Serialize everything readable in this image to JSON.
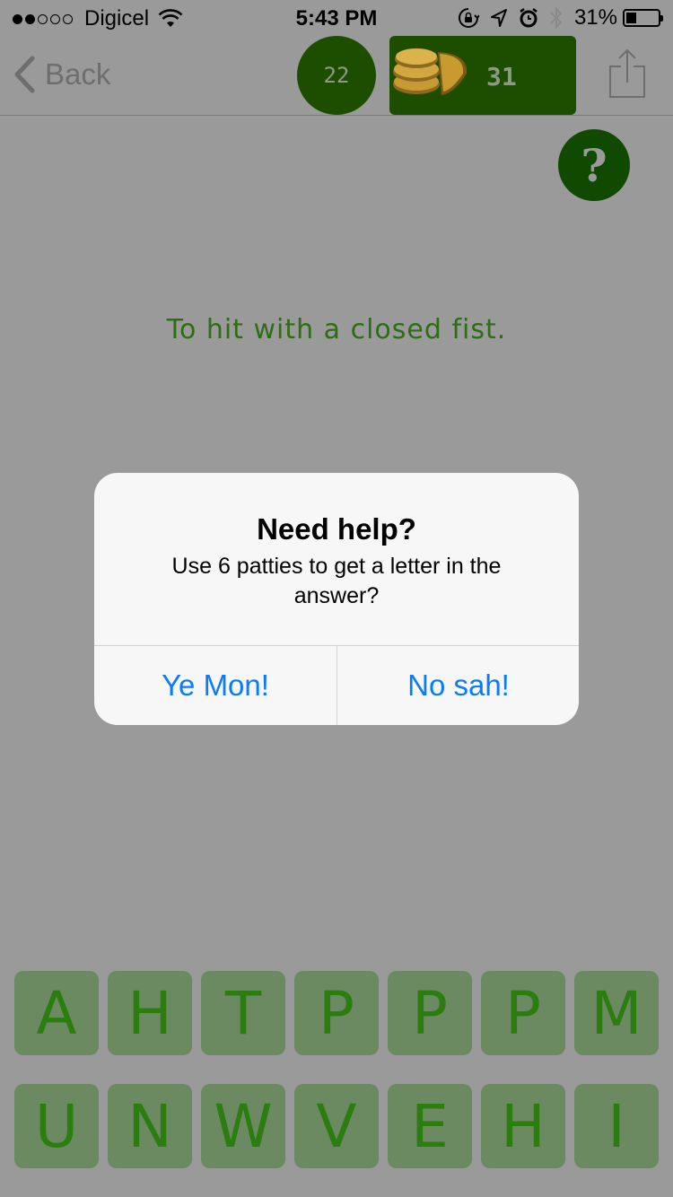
{
  "status_bar": {
    "carrier": "Digicel",
    "time": "5:43 PM",
    "battery_percent": "31%",
    "battery_level": 0.31,
    "signal_bars": 2,
    "icons": [
      "wifi-icon",
      "orientation-lock-icon",
      "location-icon",
      "alarm-icon",
      "bluetooth-icon",
      "battery-icon"
    ]
  },
  "nav": {
    "back_label": "Back",
    "level": "22",
    "patties_count": "31",
    "icons": [
      "chevron-left-icon",
      "patty-icon",
      "share-icon"
    ]
  },
  "help": {
    "label": "?"
  },
  "clue": {
    "text": "To hit with a closed fist."
  },
  "alert": {
    "title": "Need help?",
    "message": "Use 6 patties to get a letter in the answer?",
    "confirm_label": "Ye Mon!",
    "cancel_label": "No sah!"
  },
  "tiles": {
    "row1": [
      "A",
      "H",
      "T",
      "P",
      "P",
      "P",
      "M"
    ],
    "row2": [
      "U",
      "N",
      "W",
      "V",
      "E",
      "H",
      "I"
    ]
  },
  "colors": {
    "overlay_bg": "#9a9a9a",
    "badge_green": "#1d4e00",
    "tile_bg": "#6c8a61",
    "tile_text": "#2a7d0e",
    "clue_text": "#2d6d14",
    "alert_button": "#0a7aff"
  }
}
